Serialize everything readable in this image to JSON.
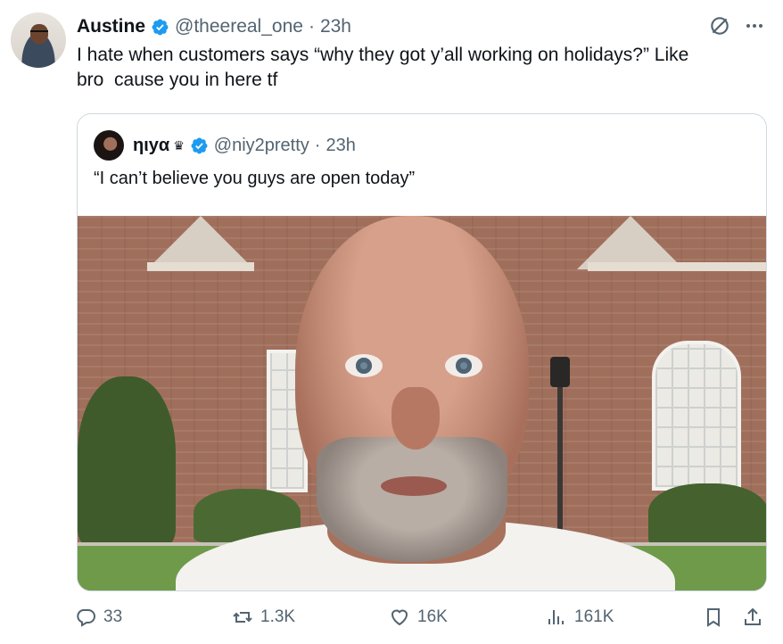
{
  "tweet": {
    "author_name": "Austine",
    "handle": "@theereal_one",
    "separator": "·",
    "time": "23h",
    "text": "I hate when customers says “why they got y’all working on holidays?” Like\nbro  cause you in here tf"
  },
  "quote": {
    "author_name": "ηιуα",
    "crown": "♛",
    "handle": "@niy2pretty",
    "separator": "·",
    "time": "23h",
    "text": "“I can’t believe you guys are open today”"
  },
  "actions": {
    "replies": "33",
    "reposts": "1.3K",
    "likes": "16K",
    "views": "161K"
  },
  "icons": {
    "verified": "verified-badge-icon",
    "grok": "grok-icon",
    "more": "more-icon",
    "reply": "reply-icon",
    "repost": "repost-icon",
    "like": "heart-icon",
    "views": "views-icon",
    "bookmark": "bookmark-icon",
    "share": "share-icon"
  },
  "colors": {
    "verified": "#1d9bf0",
    "secondary_text": "#536471",
    "primary_text": "#0f1419",
    "border": "#cfd9de"
  }
}
